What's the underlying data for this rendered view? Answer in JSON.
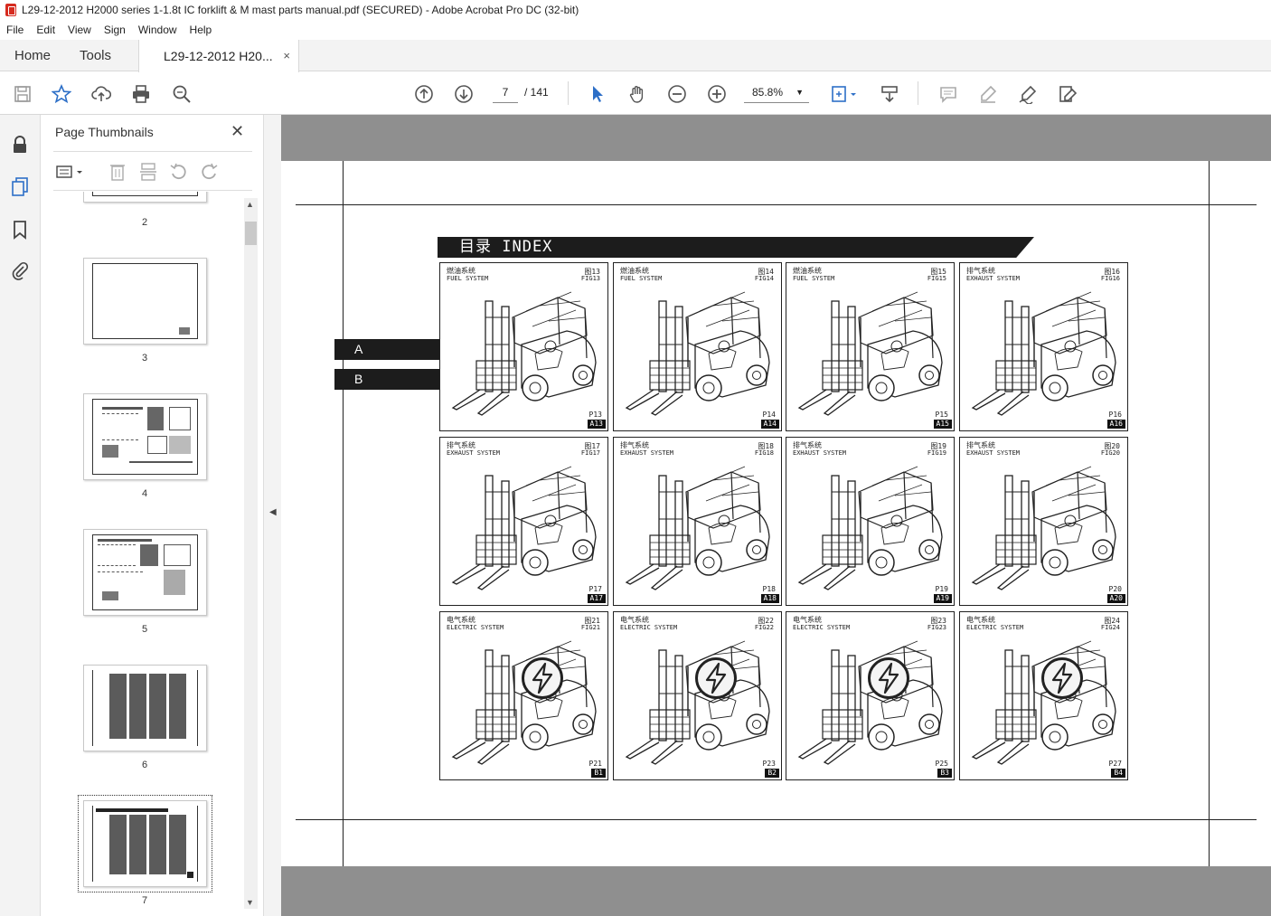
{
  "window": {
    "title": "L29-12-2012 H2000 series 1-1.8t IC forklift & M mast parts manual.pdf (SECURED) - Adobe Acrobat Pro DC (32-bit)"
  },
  "menu": [
    "File",
    "Edit",
    "View",
    "Sign",
    "Window",
    "Help"
  ],
  "tabs": {
    "home": "Home",
    "tools": "Tools",
    "document": "L29-12-2012 H20...",
    "close": "×"
  },
  "toolbar": {
    "current_page": "7",
    "total_pages": "/  141",
    "zoom": "85.8%"
  },
  "panel": {
    "title": "Page Thumbnails",
    "close": "✕",
    "thumbnails": [
      {
        "label": "2"
      },
      {
        "label": "3"
      },
      {
        "label": "4"
      },
      {
        "label": "5"
      },
      {
        "label": "6"
      },
      {
        "label": "7",
        "active": true
      }
    ]
  },
  "document": {
    "index_title": "目录  INDEX",
    "section_tabs": [
      "A",
      "B"
    ],
    "cells": [
      {
        "cn": "燃油系统",
        "en": "FUEL SYSTEM",
        "fig_cn": "图13",
        "fig_en": "FIG13",
        "page": "P13",
        "code": "A13",
        "electric": false
      },
      {
        "cn": "燃油系统",
        "en": "FUEL SYSTEM",
        "fig_cn": "图14",
        "fig_en": "FIG14",
        "page": "P14",
        "code": "A14",
        "electric": false
      },
      {
        "cn": "燃油系统",
        "en": "FUEL SYSTEM",
        "fig_cn": "图15",
        "fig_en": "FIG15",
        "page": "P15",
        "code": "A15",
        "electric": false
      },
      {
        "cn": "排气系统",
        "en": "EXHAUST SYSTEM",
        "fig_cn": "图16",
        "fig_en": "FIG16",
        "page": "P16",
        "code": "A16",
        "electric": false
      },
      {
        "cn": "排气系统",
        "en": "EXHAUST SYSTEM",
        "fig_cn": "图17",
        "fig_en": "FIG17",
        "page": "P17",
        "code": "A17",
        "electric": false
      },
      {
        "cn": "排气系统",
        "en": "EXHAUST SYSTEM",
        "fig_cn": "图18",
        "fig_en": "FIG18",
        "page": "P18",
        "code": "A18",
        "electric": false
      },
      {
        "cn": "排气系统",
        "en": "EXHAUST SYSTEM",
        "fig_cn": "图19",
        "fig_en": "FIG19",
        "page": "P19",
        "code": "A19",
        "electric": false
      },
      {
        "cn": "排气系统",
        "en": "EXHAUST SYSTEM",
        "fig_cn": "图20",
        "fig_en": "FIG20",
        "page": "P20",
        "code": "A20",
        "electric": false
      },
      {
        "cn": "电气系统",
        "en": "ELECTRIC SYSTEM",
        "fig_cn": "图21",
        "fig_en": "FIG21",
        "page": "P21",
        "code": "B1",
        "electric": true
      },
      {
        "cn": "电气系统",
        "en": "ELECTRIC SYSTEM",
        "fig_cn": "图22",
        "fig_en": "FIG22",
        "page": "P23",
        "code": "B2",
        "electric": true
      },
      {
        "cn": "电气系统",
        "en": "ELECTRIC SYSTEM",
        "fig_cn": "图23",
        "fig_en": "FIG23",
        "page": "P25",
        "code": "B3",
        "electric": true
      },
      {
        "cn": "电气系统",
        "en": "ELECTRIC SYSTEM",
        "fig_cn": "图24",
        "fig_en": "FIG24",
        "page": "P27",
        "code": "B4",
        "electric": true
      }
    ]
  }
}
